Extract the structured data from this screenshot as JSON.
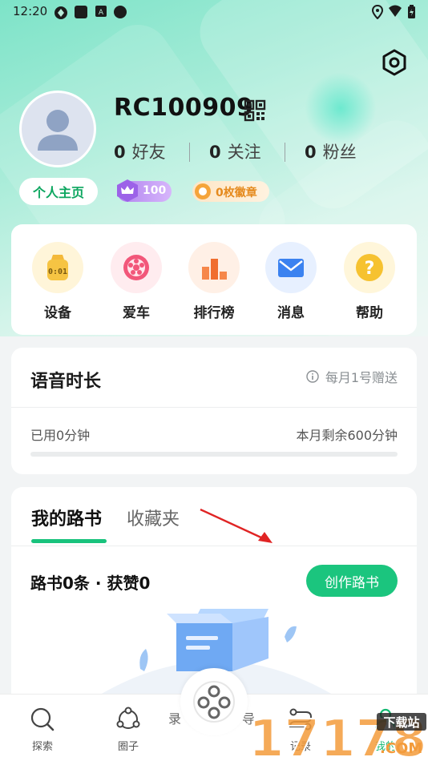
{
  "status_bar": {
    "time": "12:20"
  },
  "profile": {
    "username": "RC100909",
    "stats": [
      {
        "num": "0",
        "label": "好友"
      },
      {
        "num": "0",
        "label": "关注"
      },
      {
        "num": "0",
        "label": "粉丝"
      }
    ],
    "home_button": "个人主页",
    "level": "100",
    "medals": "0枚徽章"
  },
  "quick_menu": [
    {
      "label": "设备",
      "icon": "device-icon"
    },
    {
      "label": "爱车",
      "icon": "wheel-icon"
    },
    {
      "label": "排行榜",
      "icon": "ranking-icon"
    },
    {
      "label": "消息",
      "icon": "mail-icon"
    },
    {
      "label": "帮助",
      "icon": "help-icon"
    }
  ],
  "voice": {
    "title": "语音时长",
    "note": "每月1号赠送",
    "used": "已用0分钟",
    "remaining": "本月剩余600分钟",
    "progress": 0
  },
  "roadbook": {
    "tabs": [
      "我的路书",
      "收藏夹"
    ],
    "count_text": "路书0条 · 获赞0",
    "create_button": "创作路书"
  },
  "bottom_nav": {
    "items": [
      {
        "label": "探索",
        "icon": "explore-icon"
      },
      {
        "label": "圈子",
        "icon": "circle-icon"
      },
      {
        "label": "记录",
        "icon": "record-icon"
      },
      {
        "label": "我的",
        "icon": "profile-icon"
      }
    ],
    "partial_left": "录",
    "partial_right": "导"
  },
  "watermark": {
    "text": "17178",
    "badge": "下载站",
    "domain": ".COM"
  },
  "colors": {
    "accent": "#1bc57e",
    "level": "#b083ef",
    "medal": "#e58a1e"
  }
}
